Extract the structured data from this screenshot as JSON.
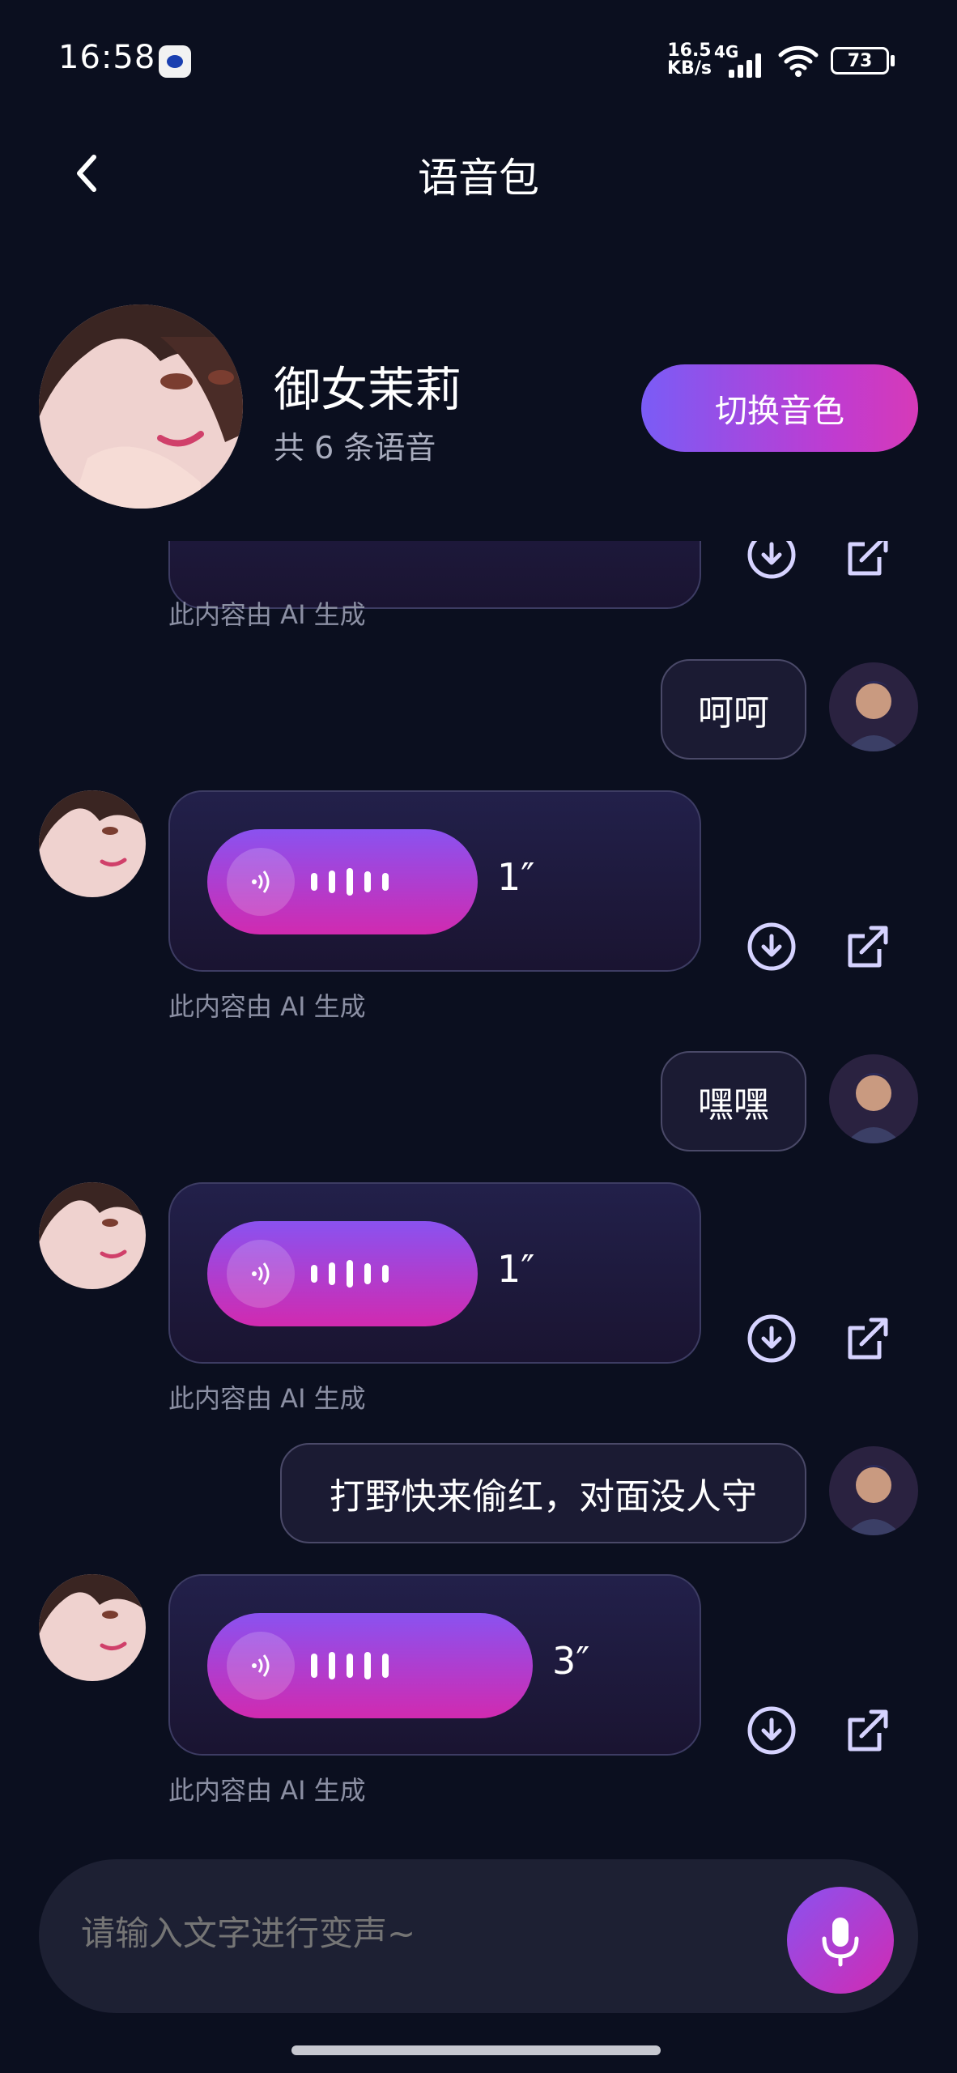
{
  "status_bar": {
    "time": "16:58",
    "net_speed_value": "16.5",
    "net_speed_unit": "KB/s",
    "network_type": "4G",
    "battery": "73"
  },
  "header": {
    "title": "语音包"
  },
  "profile": {
    "name": "御女茉莉",
    "count_text": "共 6 条语音",
    "switch_label": "切换音色"
  },
  "messages": {
    "ai_note": "此内容由 AI 生成",
    "user": [
      {
        "text": "呵呵"
      },
      {
        "text": "嘿嘿"
      },
      {
        "text": "打野快来偷红，对面没人守"
      }
    ],
    "ai": [
      {
        "duration": "1″"
      },
      {
        "duration": "1″"
      },
      {
        "duration": "3″"
      }
    ]
  },
  "input": {
    "placeholder": "请输入文字进行变声~"
  },
  "colors": {
    "accent_start": "#7a5cf6",
    "accent_end": "#d12ab0",
    "background": "#0b0f1f"
  }
}
